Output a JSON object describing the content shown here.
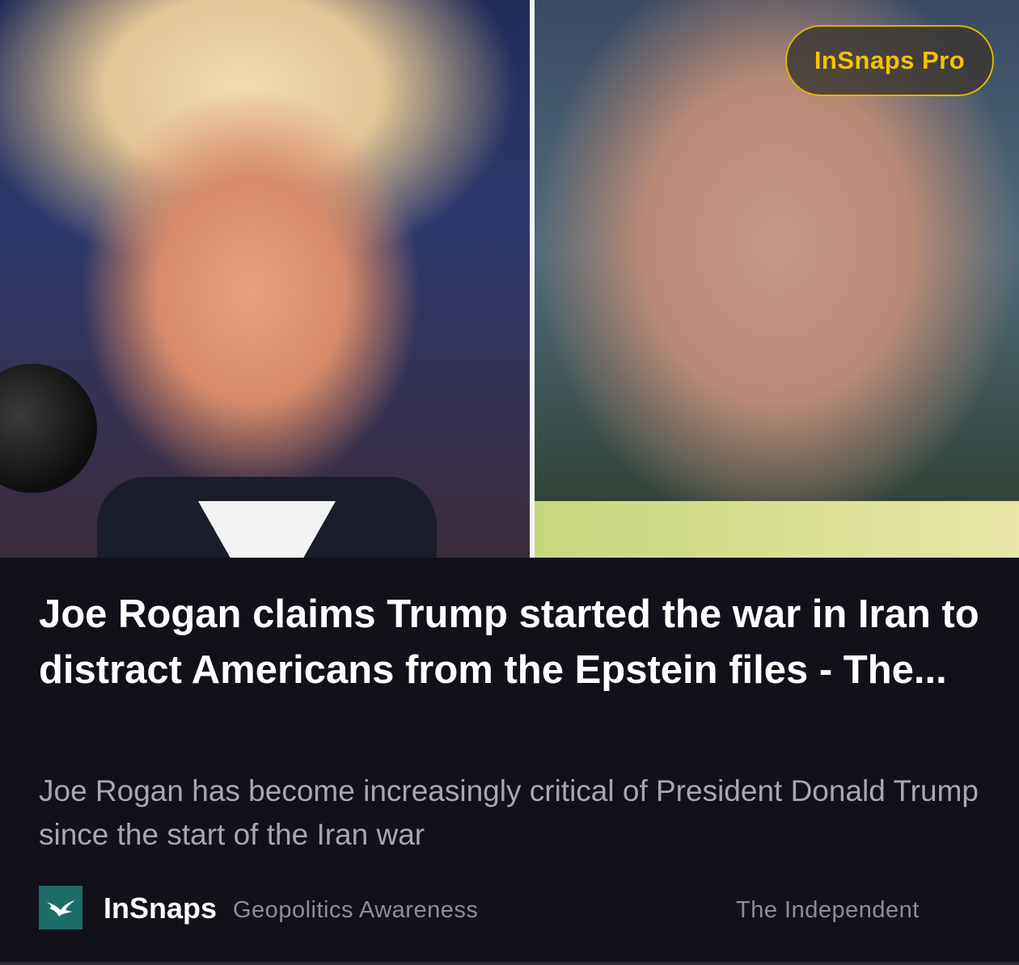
{
  "badge": {
    "label": "InSnaps Pro",
    "color": "#f2c20a"
  },
  "article": {
    "headline": "Joe Rogan claims Trump started the war in Iran to distract Americans from the Epstein files - The...",
    "summary": "Joe Rogan has become increasingly critical of President Donald Trump since the start of the Iran war"
  },
  "footer": {
    "logo_icon": "bird-icon",
    "brand": "InSnaps",
    "category": "Geopolitics Awareness",
    "source": "The Independent"
  },
  "colors": {
    "background": "#11111a",
    "logo_bg": "#1c6d68",
    "headline": "#ffffff",
    "muted_text": "#8d8d98"
  }
}
